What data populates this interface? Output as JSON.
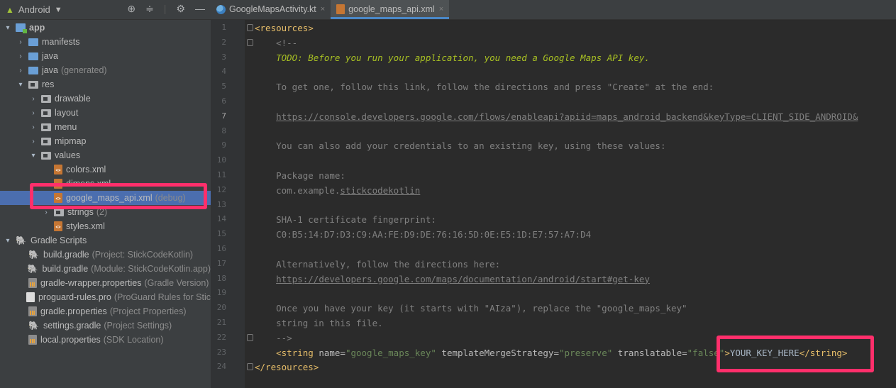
{
  "project_panel": {
    "view_selector": "Android",
    "tree": [
      {
        "label": "app",
        "extra": "",
        "arrow": "▾",
        "icon": "module-icon",
        "depth": 0,
        "bold": true
      },
      {
        "label": "manifests",
        "extra": "",
        "arrow": "›",
        "icon": "folder-icon",
        "depth": 1
      },
      {
        "label": "java",
        "extra": "",
        "arrow": "›",
        "icon": "folder-icon",
        "depth": 1
      },
      {
        "label": "java",
        "extra": "(generated)",
        "arrow": "›",
        "icon": "generated-folder-icon",
        "depth": 1
      },
      {
        "label": "res",
        "extra": "",
        "arrow": "▾",
        "icon": "resource-folder-icon",
        "depth": 1
      },
      {
        "label": "drawable",
        "extra": "",
        "arrow": "›",
        "icon": "folder-icon",
        "depth": 2
      },
      {
        "label": "layout",
        "extra": "",
        "arrow": "›",
        "icon": "folder-icon",
        "depth": 2
      },
      {
        "label": "menu",
        "extra": "",
        "arrow": "›",
        "icon": "folder-icon",
        "depth": 2
      },
      {
        "label": "mipmap",
        "extra": "",
        "arrow": "›",
        "icon": "folder-icon",
        "depth": 2
      },
      {
        "label": "values",
        "extra": "",
        "arrow": "▾",
        "icon": "folder-icon",
        "depth": 2
      },
      {
        "label": "colors.xml",
        "extra": "",
        "arrow": "",
        "icon": "xml-file-icon",
        "depth": 3
      },
      {
        "label": "dimens.xml",
        "extra": "",
        "arrow": "",
        "icon": "xml-file-icon",
        "depth": 3
      },
      {
        "label": "google_maps_api.xml",
        "extra": "(debug)",
        "arrow": "",
        "icon": "xml-file-icon",
        "depth": 3,
        "selected": true
      },
      {
        "label": "strings",
        "extra": "(2)",
        "arrow": "›",
        "icon": "folder-icon",
        "depth": 3
      },
      {
        "label": "styles.xml",
        "extra": "",
        "arrow": "",
        "icon": "xml-file-icon",
        "depth": 3
      },
      {
        "label": "Gradle Scripts",
        "extra": "",
        "arrow": "▾",
        "icon": "gradle-icon",
        "depth": 0
      },
      {
        "label": "build.gradle",
        "extra": "(Project: StickCodeKotlin)",
        "arrow": "",
        "icon": "gradle-icon",
        "depth": 1
      },
      {
        "label": "build.gradle",
        "extra": "(Module: StickCodeKotlin.app)",
        "arrow": "",
        "icon": "gradle-icon",
        "depth": 1
      },
      {
        "label": "gradle-wrapper.properties",
        "extra": "(Gradle Version)",
        "arrow": "",
        "icon": "properties-file-icon",
        "depth": 1
      },
      {
        "label": "proguard-rules.pro",
        "extra": "(ProGuard Rules for Stic",
        "arrow": "",
        "icon": "pro-file-icon",
        "depth": 1
      },
      {
        "label": "gradle.properties",
        "extra": "(Project Properties)",
        "arrow": "",
        "icon": "properties-file-icon",
        "depth": 1
      },
      {
        "label": "settings.gradle",
        "extra": "(Project Settings)",
        "arrow": "",
        "icon": "gradle-icon",
        "depth": 1
      },
      {
        "label": "local.properties",
        "extra": "(SDK Location)",
        "arrow": "",
        "icon": "properties-file-icon",
        "depth": 1
      }
    ]
  },
  "editor": {
    "tabs": [
      {
        "label": "GoogleMapsActivity.kt",
        "icon": "kotlin-file-icon",
        "active": false
      },
      {
        "label": "google_maps_api.xml",
        "icon": "xml-file-icon",
        "active": true
      }
    ],
    "current_line": 7,
    "lines": [
      [
        {
          "t": "<resources>",
          "c": "c-tag"
        }
      ],
      [
        {
          "t": "    <!--",
          "c": "c-comment"
        }
      ],
      [
        {
          "t": "    ",
          "c": "c-comment"
        },
        {
          "t": "TODO: Before you run your application, you need a Google Maps API key.",
          "c": "c-todo"
        }
      ],
      [],
      [
        {
          "t": "    To get one, follow this link, follow the directions and press \"Create\" at the end:",
          "c": "c-comment"
        }
      ],
      [],
      [
        {
          "t": "    ",
          "c": "c-comment"
        },
        {
          "t": "https://console.developers.google.com/flows/enableapi?apiid=maps_android_backend&keyType=CLIENT_SIDE_ANDROID&",
          "c": "c-url"
        }
      ],
      [],
      [
        {
          "t": "    You can also add your credentials to an existing key, using these values:",
          "c": "c-comment"
        }
      ],
      [],
      [
        {
          "t": "    Package name:",
          "c": "c-comment"
        }
      ],
      [
        {
          "t": "    com.example.",
          "c": "c-comment"
        },
        {
          "t": "stickcodekotlin",
          "c": "c-comment c-under"
        }
      ],
      [],
      [
        {
          "t": "    SHA-1 certificate fingerprint:",
          "c": "c-comment"
        }
      ],
      [
        {
          "t": "    C0:B5:14:D7:D3:C9:AA:FE:D9:DE:76:16:5D:0E:E5:1D:E7:57:A7:D4",
          "c": "c-comment"
        }
      ],
      [],
      [
        {
          "t": "    Alternatively, follow the directions here:",
          "c": "c-comment"
        }
      ],
      [
        {
          "t": "    ",
          "c": "c-comment"
        },
        {
          "t": "https://developers.google.com/maps/documentation/android/start#get-key",
          "c": "c-url"
        }
      ],
      [],
      [
        {
          "t": "    Once you have your key (it starts with \"AIza\"), replace the \"google_maps_key\"",
          "c": "c-comment"
        }
      ],
      [
        {
          "t": "    string in this file.",
          "c": "c-comment"
        }
      ],
      [
        {
          "t": "    -->",
          "c": "c-comment"
        }
      ],
      [
        {
          "t": "    <string ",
          "c": "c-tag"
        },
        {
          "t": "name=",
          "c": "c-attr"
        },
        {
          "t": "\"google_maps_key\" ",
          "c": "c-val"
        },
        {
          "t": "templateMergeStrategy=",
          "c": "c-attr"
        },
        {
          "t": "\"preserve\" ",
          "c": "c-val"
        },
        {
          "t": "translatable=",
          "c": "c-attr"
        },
        {
          "t": "\"false\"",
          "c": "c-val"
        },
        {
          "t": ">",
          "c": "c-tag"
        },
        {
          "t": "YOUR_KEY_HERE",
          "c": ""
        },
        {
          "t": "</string>",
          "c": "c-tag"
        }
      ],
      [
        {
          "t": "</resources>",
          "c": "c-tag"
        }
      ]
    ]
  },
  "highlights": {
    "color": "#ff2f6b"
  }
}
